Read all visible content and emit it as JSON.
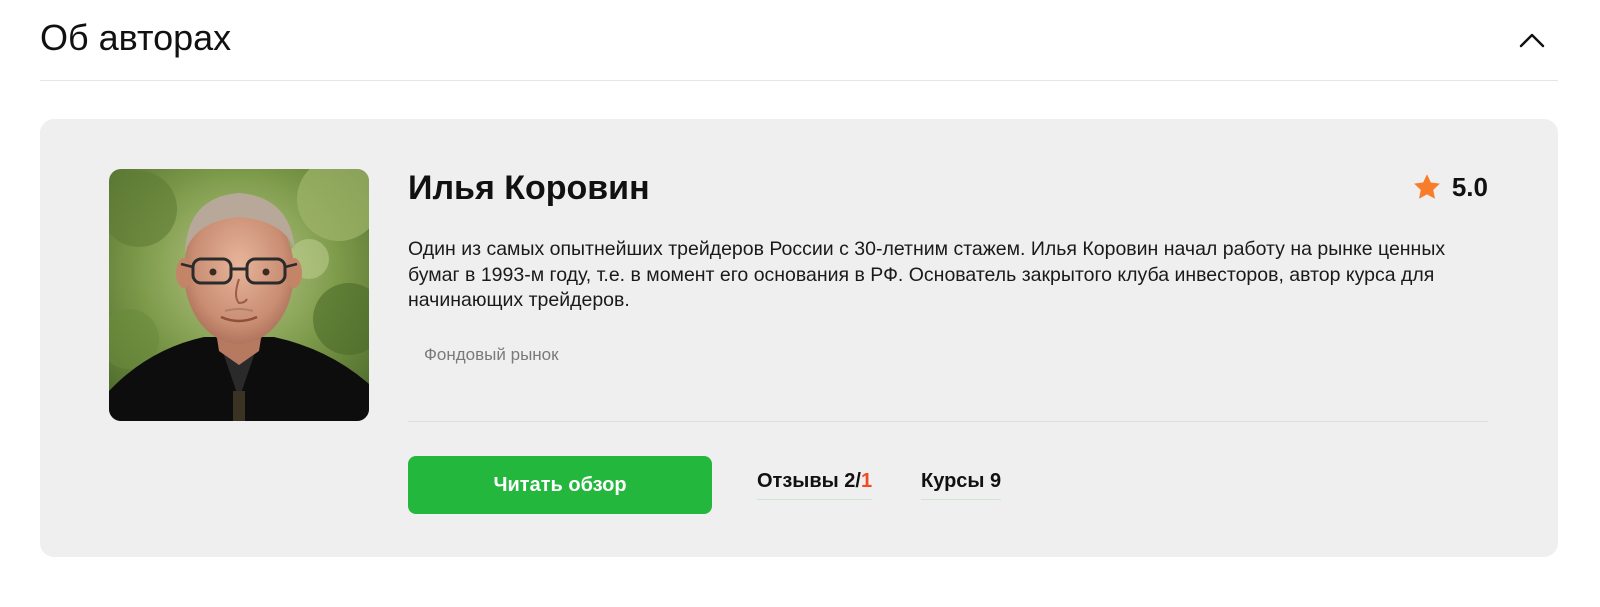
{
  "section": {
    "title": "Об авторах"
  },
  "author": {
    "name": "Илья Коровин",
    "rating": "5.0",
    "bio": "Один из самых опытнейших трейдеров России с 30-летним стажем. Илья Коровин начал работу на рынке ценных бумаг в 1993-м году, т.е. в момент его основания в РФ. Основатель закрытого клуба инвесторов, автор курса для начинающих трейдеров.",
    "tag": "Фондовый рынок"
  },
  "actions": {
    "read_review": "Читать обзор",
    "reviews_label": "Отзывы 2/",
    "reviews_negative": "1",
    "courses_label": "Курсы 9"
  },
  "colors": {
    "accent_green": "#24b73d",
    "star_orange": "#f77d2a",
    "negative_red": "#f04b23",
    "card_bg": "#efefef"
  },
  "icons": {
    "collapse": "chevron-up-icon",
    "rating": "star-icon"
  }
}
